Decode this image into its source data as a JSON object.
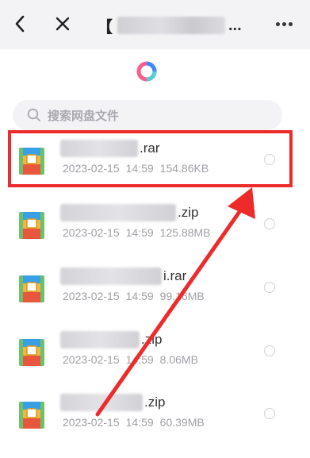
{
  "header": {
    "back_icon": "chevron-left-icon",
    "close_icon": "close-icon",
    "title_prefix": "【",
    "title_suffix": "...",
    "more_icon": "more-dots-icon"
  },
  "search": {
    "placeholder": "搜索网盘文件",
    "icon": "search-icon"
  },
  "files": [
    {
      "ext": ".rar",
      "date": "2023-02-15",
      "time": "14:59",
      "size": "154.86KB"
    },
    {
      "ext": ".zip",
      "date": "2023-02-15",
      "time": "14:59",
      "size": "125.88MB"
    },
    {
      "ext": "i.rar",
      "date": "2023-02-15",
      "time": "14:59",
      "size": "99.16MB"
    },
    {
      "ext": ".zip",
      "date": "2023-02-15",
      "time": "14:59",
      "size": "8.06MB"
    },
    {
      "ext": ".zip",
      "date": "2023-02-15",
      "time": "14:59",
      "size": "60.39MB"
    }
  ],
  "colors": {
    "highlight": "#ee2b2b",
    "archive_icon_top": "#3aa0e6",
    "archive_icon_mid": "#f4b53f",
    "archive_icon_bottom": "#e8573d",
    "archive_icon_side": "#6cc26b"
  }
}
